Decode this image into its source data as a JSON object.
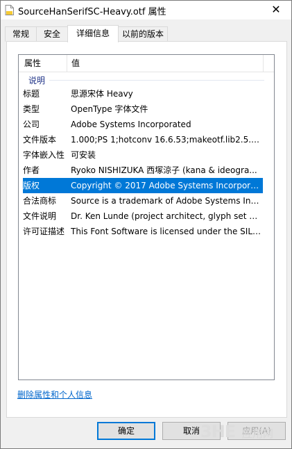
{
  "window": {
    "title": "SourceHanSerifSC-Heavy.otf 属性",
    "close_glyph": "✕"
  },
  "tabs": [
    "常规",
    "安全",
    "详细信息",
    "以前的版本"
  ],
  "list": {
    "header": {
      "property": "属性",
      "value": "值"
    },
    "group": "说明",
    "rows": [
      {
        "k": "标题",
        "v": "思源宋体 Heavy"
      },
      {
        "k": "类型",
        "v": "OpenType 字体文件"
      },
      {
        "k": "公司",
        "v": "Adobe Systems Incorporated"
      },
      {
        "k": "文件版本",
        "v": "1.000;PS 1;hotconv 16.6.53;makeotf.lib2.5.65..."
      },
      {
        "k": "字体嵌入性",
        "v": "可安装"
      },
      {
        "k": "作者",
        "v": "Ryoko NISHIZUKA 西塚涼子 (kana & ideogra..."
      },
      {
        "k": "版权",
        "v": "Copyright © 2017 Adobe Systems Incorpora..."
      },
      {
        "k": "合法商标",
        "v": "Source is a trademark of Adobe Systems Inc..."
      },
      {
        "k": "文件说明",
        "v": "Dr. Ken Lunde (project architect, glyph set d..."
      },
      {
        "k": "许可证描述",
        "v": "This Font Software is licensed under the SIL ..."
      }
    ]
  },
  "link": "删除属性和个人信息",
  "buttons": {
    "ok": "确定",
    "cancel": "取消",
    "apply": "应用(A)"
  },
  "watermark": {
    "logo": "3HE",
    "text": "应用网"
  }
}
